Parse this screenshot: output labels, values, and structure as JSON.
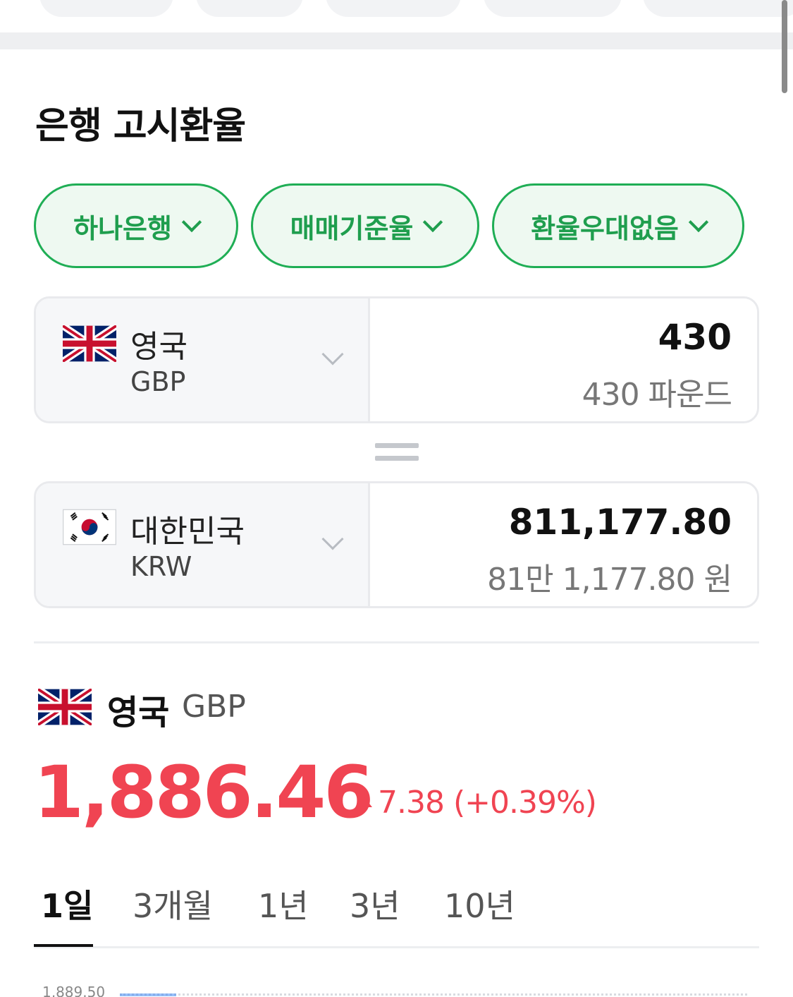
{
  "section": {
    "title": "은행 고시환율"
  },
  "filters": [
    {
      "label": "하나은행"
    },
    {
      "label": "매매기준율"
    },
    {
      "label": "환율우대없음"
    }
  ],
  "converter": {
    "from": {
      "country": "영국",
      "code": "GBP",
      "amount": "430",
      "amount_text": "430 파운드",
      "flag": "uk-flag-icon"
    },
    "to": {
      "country": "대한민국",
      "code": "KRW",
      "amount": "811,177.80",
      "amount_text": "81만 1,177.80 원",
      "flag": "korea-flag-icon"
    }
  },
  "rate": {
    "country": "영국",
    "code": "GBP",
    "value": "1,886.46",
    "change": "7.38 (+0.39%)",
    "color": "#f04452"
  },
  "periods": [
    {
      "label": "1일",
      "active": true
    },
    {
      "label": "3개월",
      "active": false
    },
    {
      "label": "1년",
      "active": false
    },
    {
      "label": "3년",
      "active": false
    },
    {
      "label": "10년",
      "active": false
    }
  ],
  "chart": {
    "top_label": "1,889.50"
  },
  "colors": {
    "accent": "#1fae55",
    "rise": "#f04452"
  }
}
